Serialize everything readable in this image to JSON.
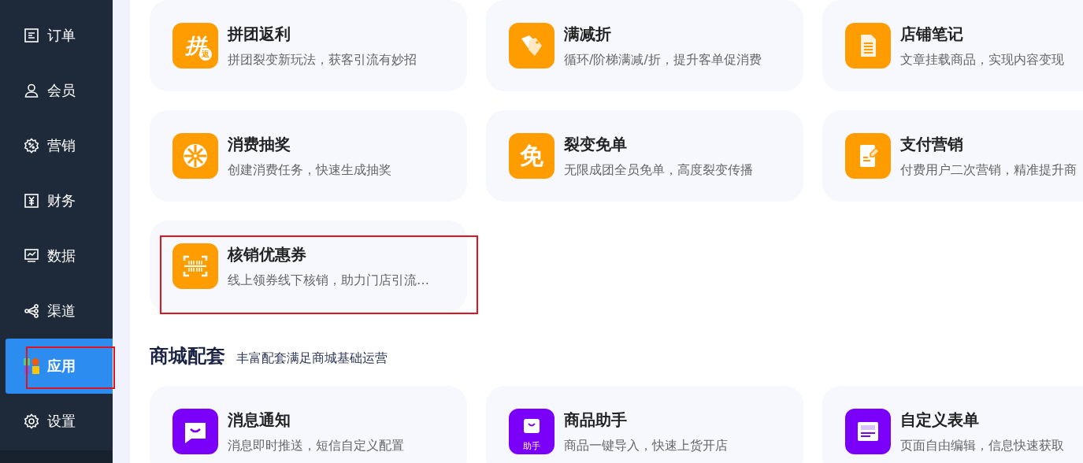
{
  "sidebar": {
    "items": [
      {
        "label": "订单",
        "kind": "order",
        "selected": false,
        "highlighted": false
      },
      {
        "label": "会员",
        "kind": "user",
        "selected": false,
        "highlighted": false
      },
      {
        "label": "营销",
        "kind": "promo",
        "selected": false,
        "highlighted": false
      },
      {
        "label": "财务",
        "kind": "finance",
        "selected": false,
        "highlighted": false
      },
      {
        "label": "数据",
        "kind": "data",
        "selected": false,
        "highlighted": false
      },
      {
        "label": "渠道",
        "kind": "channel",
        "selected": false,
        "highlighted": false
      },
      {
        "label": "应用",
        "kind": "apps",
        "selected": true,
        "highlighted": true
      },
      {
        "label": "设置",
        "kind": "settings",
        "selected": false,
        "highlighted": false
      }
    ]
  },
  "sections": [
    {
      "kind": "marketing",
      "cards": [
        {
          "title": "拼团返利",
          "description": "拼团裂变新玩法，获客引流有妙招",
          "kind": "group",
          "icon_text": "拼",
          "icon_badge": "返",
          "highlighted": false
        },
        {
          "title": "满减折",
          "description": "循环/阶梯满减/折，提升客单促消费",
          "kind": "tags",
          "highlighted": false
        },
        {
          "title": "店铺笔记",
          "description": "文章挂载商品，实现内容变现",
          "kind": "note",
          "highlighted": false
        },
        {
          "title": "消费抽奖",
          "description": "创建消费任务，快速生成抽奖",
          "kind": "wheel",
          "highlighted": false
        },
        {
          "title": "裂变免单",
          "description": "无限成团全员免单，高度裂变传播",
          "kind": "glyph",
          "icon_text": "免",
          "highlighted": false
        },
        {
          "title": "支付营销",
          "description": "付费用户二次营销，精准提升商",
          "kind": "pay",
          "highlighted": false
        },
        {
          "title": "核销优惠券",
          "description": "线上领券线下核销，助力门店引流…",
          "kind": "scan",
          "highlighted": true
        }
      ]
    },
    {
      "kind": "mall",
      "title": "商城配套",
      "subtitle": "丰富配套满足商城基础运营",
      "cards": [
        {
          "title": "消息通知",
          "description": "消息即时推送，短信自定义配置",
          "kind": "message",
          "highlighted": false
        },
        {
          "title": "商品助手",
          "description": "商品一键导入，快速上货开店",
          "kind": "bag",
          "icon_text": "助手",
          "highlighted": false
        },
        {
          "title": "自定义表单",
          "description": "页面自由编辑，信息快速获取",
          "kind": "form",
          "highlighted": false
        }
      ]
    }
  ]
}
